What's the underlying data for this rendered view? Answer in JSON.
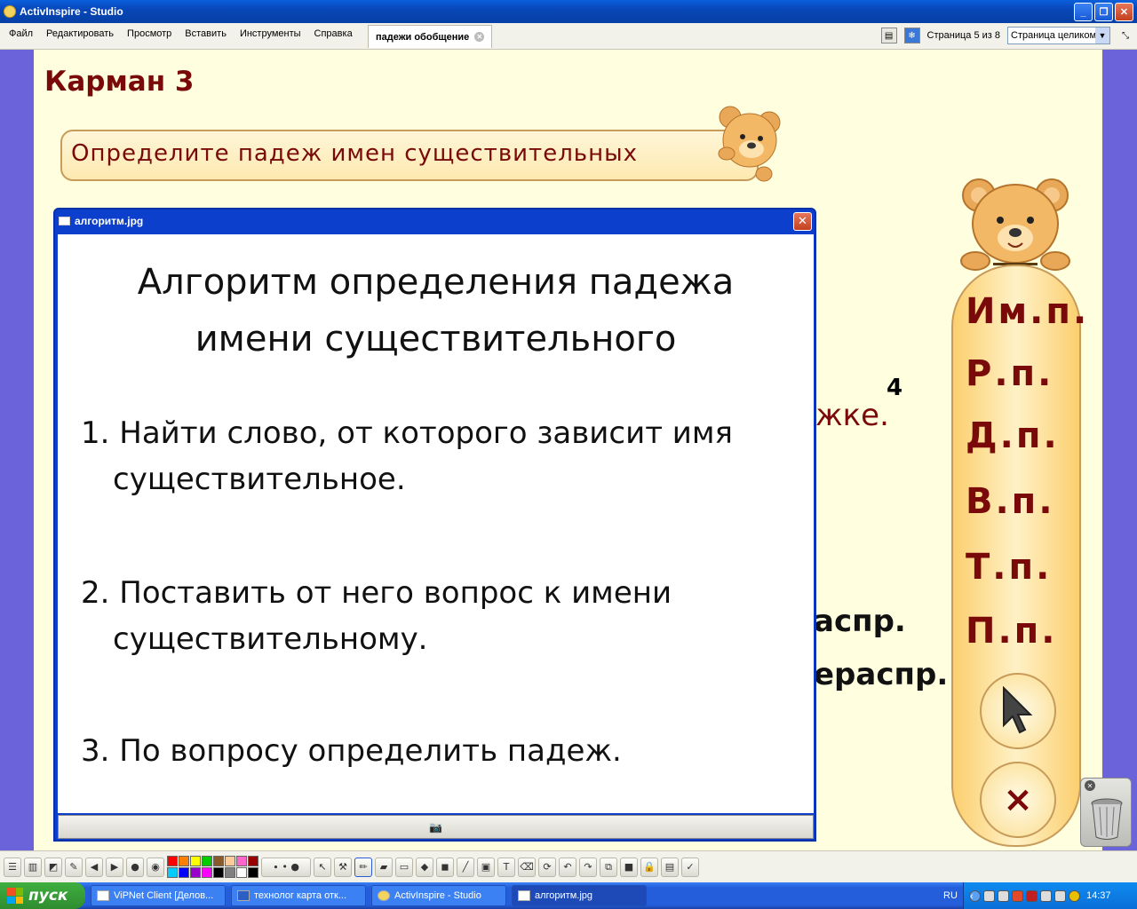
{
  "app": {
    "title": "ActivInspire - Studio"
  },
  "menu": [
    "Файл",
    "Редактировать",
    "Просмотр",
    "Вставить",
    "Инструменты",
    "Справка"
  ],
  "doc_tab": {
    "label": "падежи обобщение"
  },
  "page_info": "Страница 5 из 8",
  "zoom": {
    "selected": "Страница целиком"
  },
  "slide": {
    "heading": "Карман 3",
    "instruction": "Определите падеж имен существительных",
    "partial_texts": [
      "жке.",
      "4",
      "аспр.",
      "ераспр."
    ],
    "cases": [
      "Им.п.",
      "Р.п.",
      "Д.п.",
      "В.п.",
      "Т.п.",
      "П.п."
    ],
    "close_glyph": "×"
  },
  "popup": {
    "title": "алгоритм.jpg",
    "heading_line1": "Алгоритм определения падежа",
    "heading_line2": "имени существительного",
    "steps": [
      {
        "line1": "1. Найти слово, от которого зависит имя",
        "line2": "существительное."
      },
      {
        "line1": "2. Поставить от него вопрос к имени",
        "line2": "существительному."
      },
      {
        "line1": "3. По вопросу определить падеж.",
        "line2": ""
      }
    ]
  },
  "palette": [
    "#ff0000",
    "#ff8000",
    "#ffff00",
    "#00cc00",
    "#8b5a2b",
    "#ffcc99",
    "#ff66cc",
    "#990000",
    "#00ccff",
    "#0000ff",
    "#9900cc",
    "#ff00ff",
    "#000000",
    "#808080",
    "#ffffff",
    "#000000"
  ],
  "taskbar": {
    "start": "пуск",
    "tasks": [
      "ViPNet Client [Делов...",
      "технолог карта отк...",
      "ActivInspire - Studio",
      "алгоритм.jpg"
    ],
    "lang": "RU",
    "clock": "14:37"
  }
}
